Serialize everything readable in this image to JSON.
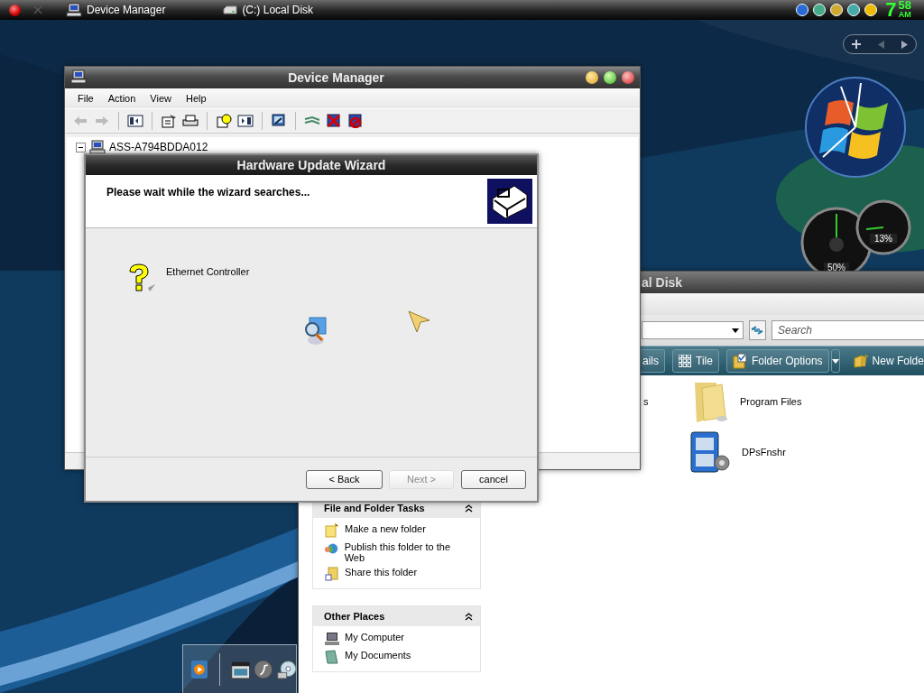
{
  "taskbar": {
    "tasks": [
      {
        "label": "Device Manager",
        "kind": "computer"
      },
      {
        "label": "(C:) Local Disk",
        "kind": "drive"
      }
    ],
    "clock": {
      "hour": "7",
      "minute": "58",
      "period": "AM"
    }
  },
  "gadgets": {
    "gauges": [
      {
        "reading": "50%"
      },
      {
        "reading": "13%"
      }
    ]
  },
  "explorer": {
    "title": "al Disk",
    "search": {
      "placeholder": "Search"
    },
    "toolbar": [
      {
        "label": "ails",
        "kind": "plain"
      },
      {
        "label": "Tile",
        "kind": "tile"
      },
      {
        "label": "Folder Options",
        "kind": "options"
      },
      {
        "label": "New Folde",
        "kind": "newfolder"
      }
    ],
    "task_panels": [
      {
        "title": "File and Folder Tasks",
        "expanded": true,
        "items": [
          "Make a new folder",
          "Publish this folder to the Web",
          "Share this folder"
        ]
      },
      {
        "title": "Other Places",
        "expanded": true,
        "items": [
          "My Computer",
          "My Documents"
        ]
      }
    ],
    "files": [
      {
        "name": "s",
        "kind": "cut"
      },
      {
        "name": "Program Files",
        "kind": "folder"
      },
      {
        "name": "DPsFnshr",
        "kind": "program"
      }
    ]
  },
  "device_manager": {
    "title": "Device Manager",
    "menu": [
      "File",
      "Action",
      "View",
      "Help"
    ],
    "tree_root": {
      "label": "ASS-A794BDDA012",
      "expanded": true
    }
  },
  "wizard": {
    "title": "Hardware Update Wizard",
    "heading": "Please wait while the wizard searches...",
    "device": "Ethernet Controller",
    "buttons": [
      {
        "label": "< Back",
        "disabled": false
      },
      {
        "label": "Next >",
        "disabled": true
      },
      {
        "label": "cancel",
        "disabled": false
      }
    ]
  }
}
